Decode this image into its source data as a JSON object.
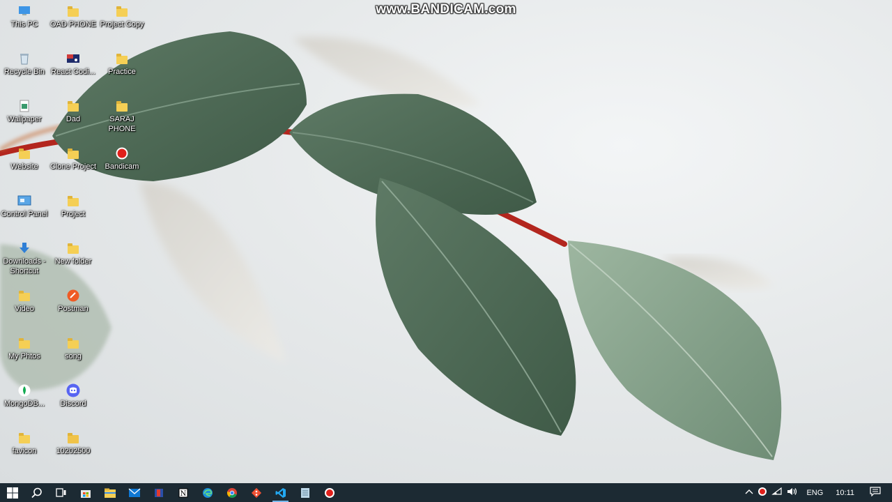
{
  "watermark": "www.BANDICAM.com",
  "desktop_icons": [
    {
      "label": "This PC",
      "icon": "computer-icon"
    },
    {
      "label": "OAD PHONE",
      "icon": "folder-icon"
    },
    {
      "label": "Project Copy",
      "icon": "folder-icon"
    },
    {
      "label": "Recycle Bin",
      "icon": "recycle-bin-icon"
    },
    {
      "label": "React Codi...",
      "icon": "react-app-icon"
    },
    {
      "label": "Practice",
      "icon": "folder-icon"
    },
    {
      "label": "Wallpaper",
      "icon": "image-file-icon"
    },
    {
      "label": "Dad",
      "icon": "folder-icon"
    },
    {
      "label": "SARAJ PHONE",
      "icon": "folder-icon"
    },
    {
      "label": "Website",
      "icon": "folder-icon"
    },
    {
      "label": "Clone Project",
      "icon": "folder-icon"
    },
    {
      "label": "Bandicam",
      "icon": "bandicam-icon"
    },
    {
      "label": "Control Panel",
      "icon": "control-panel-icon"
    },
    {
      "label": "Project",
      "icon": "folder-icon"
    },
    {
      "label": "Downloads - Shortcut",
      "icon": "download-shortcut-icon"
    },
    {
      "label": "New folder",
      "icon": "folder-icon"
    },
    {
      "label": "Video",
      "icon": "folder-icon"
    },
    {
      "label": "Postman",
      "icon": "postman-icon"
    },
    {
      "label": "My Phtos",
      "icon": "folder-icon"
    },
    {
      "label": "song",
      "icon": "folder-icon"
    },
    {
      "label": "MongoDB...",
      "icon": "mongodb-icon"
    },
    {
      "label": "Discord",
      "icon": "discord-icon"
    },
    {
      "label": "favicon",
      "icon": "folder-icon"
    },
    {
      "label": "10202500",
      "icon": "folder-zip-icon"
    }
  ],
  "taskbar": {
    "items": [
      {
        "icon": "windows-start-icon"
      },
      {
        "icon": "search-icon"
      },
      {
        "icon": "task-view-icon"
      },
      {
        "icon": "store-icon"
      },
      {
        "icon": "file-explorer-icon"
      },
      {
        "icon": "mail-icon"
      },
      {
        "icon": "app-red-icon"
      },
      {
        "icon": "notion-icon"
      },
      {
        "icon": "edge-icon"
      },
      {
        "icon": "chrome-icon"
      },
      {
        "icon": "git-icon"
      },
      {
        "icon": "vscode-icon"
      },
      {
        "icon": "notepad-icon"
      },
      {
        "icon": "bandicam-record-icon"
      }
    ],
    "tray": {
      "language": "ENG",
      "time": "10:11"
    }
  },
  "colors": {
    "taskbar_bg": "#1c2a33",
    "leaf_dark": "#4f6b57",
    "leaf_light": "#8aa68f",
    "stem_red": "#b3261e",
    "accent": "#76b9ed"
  }
}
